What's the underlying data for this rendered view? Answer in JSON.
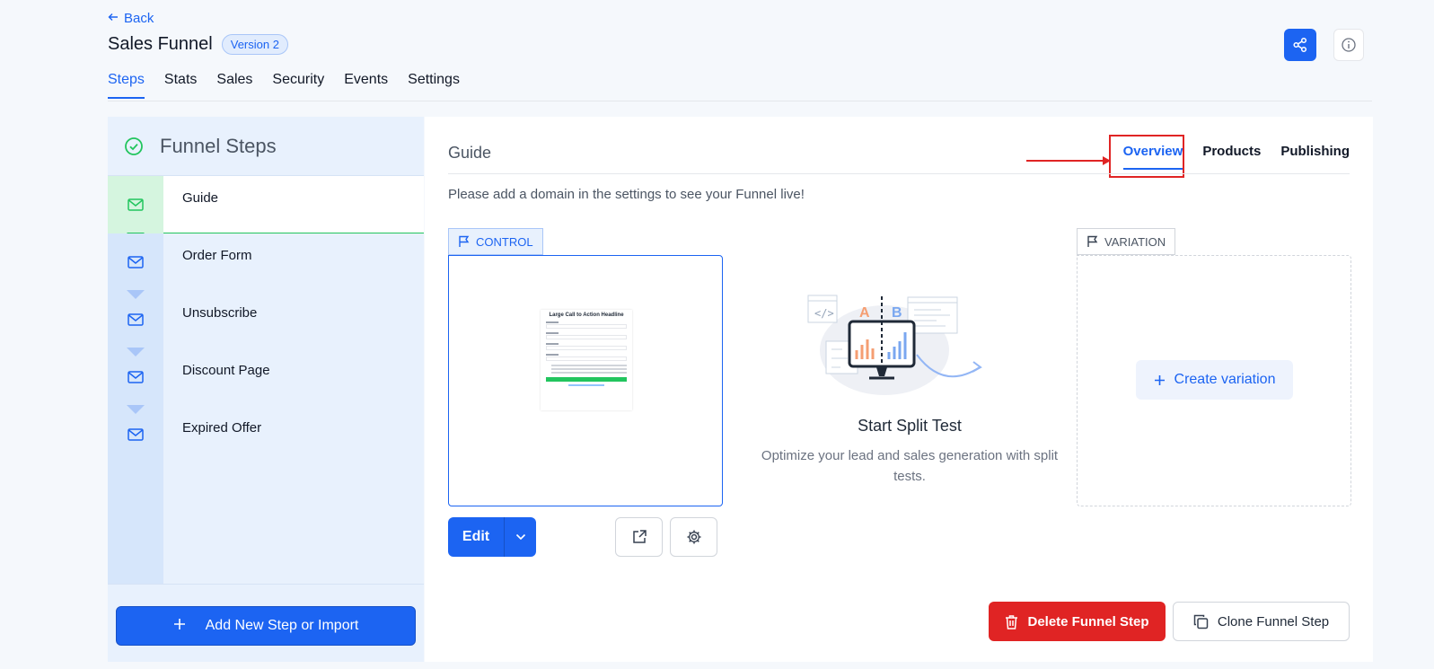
{
  "header": {
    "back_label": "Back",
    "title": "Sales Funnel",
    "version_badge": "Version 2"
  },
  "tabs": [
    {
      "label": "Steps",
      "active": true
    },
    {
      "label": "Stats"
    },
    {
      "label": "Sales"
    },
    {
      "label": "Security"
    },
    {
      "label": "Events"
    },
    {
      "label": "Settings"
    }
  ],
  "sidebar": {
    "title": "Funnel Steps",
    "steps": [
      {
        "label": "Guide",
        "active": true,
        "icon": "mail-icon"
      },
      {
        "label": "Order Form",
        "icon": "mail-icon"
      },
      {
        "label": "Unsubscribe",
        "icon": "mail-icon"
      },
      {
        "label": "Discount Page",
        "icon": "mail-icon"
      },
      {
        "label": "Expired Offer",
        "icon": "mail-icon"
      }
    ],
    "add_button": "Add New Step or Import"
  },
  "main": {
    "title": "Guide",
    "tabs": [
      {
        "label": "Overview",
        "active": true
      },
      {
        "label": "Products"
      },
      {
        "label": "Publishing"
      }
    ],
    "notice": "Please add a domain in the settings to see your Funnel live!",
    "control_label": "CONTROL",
    "preview_headline": "Large Call to Action Headline",
    "edit_label": "Edit",
    "split_title": "Start Split Test",
    "split_desc": "Optimize your lead and sales generation with split tests.",
    "variation_label": "VARIATION",
    "create_variation": "Create variation",
    "illustration_a": "A",
    "illustration_b": "B",
    "delete_label": "Delete Funnel Step",
    "clone_label": "Clone Funnel Step"
  },
  "colors": {
    "primary": "#1c64f2",
    "danger": "#e02424",
    "success": "#22c55e"
  }
}
